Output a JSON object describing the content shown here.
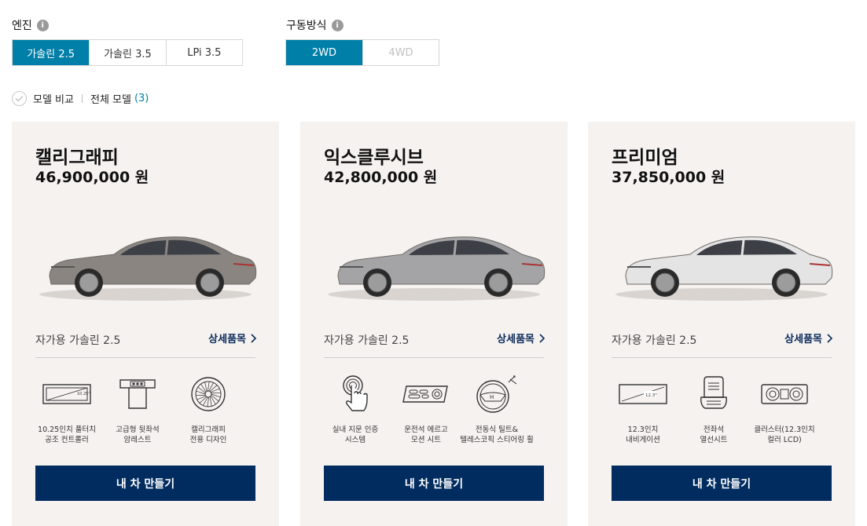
{
  "engine": {
    "label": "엔진",
    "options": [
      {
        "label": "가솔린 2.5",
        "state": "active"
      },
      {
        "label": "가솔린 3.5",
        "state": "normal"
      },
      {
        "label": "LPi 3.5",
        "state": "normal"
      }
    ]
  },
  "drive": {
    "label": "구동방식",
    "options": [
      {
        "label": "2WD",
        "state": "active"
      },
      {
        "label": "4WD",
        "state": "disabled"
      }
    ]
  },
  "compare": {
    "label": "모델 비교",
    "all_models_label": "전체 모델",
    "count": "(3)"
  },
  "colors": {
    "accent": "#007fa8",
    "navy": "#002c5f",
    "card_bg": "#f5f2f0"
  },
  "cards": [
    {
      "name": "캘리그래피",
      "price": "46,900,000 원",
      "sub": "자가용 가솔린 2.5",
      "detail": "상세품목",
      "car_color": "#8a8580",
      "features": [
        {
          "icon": "touch-screen-icon",
          "line1": "10.25인치 풀터치",
          "line2": "공조 컨트롤러",
          "badge": "10.25\""
        },
        {
          "icon": "rear-armrest-icon",
          "line1": "고급형 뒷좌석",
          "line2": "암레스트"
        },
        {
          "icon": "wheel-icon",
          "line1": "캘리그래피",
          "line2": "전용 디자인"
        }
      ],
      "cta": "내 차 만들기"
    },
    {
      "name": "익스클루시브",
      "price": "42,800,000 원",
      "sub": "자가용 가솔린 2.5",
      "detail": "상세품목",
      "car_color": "#a4a4a6",
      "features": [
        {
          "icon": "fingerprint-icon",
          "line1": "실내 지문 인증",
          "line2": "시스템"
        },
        {
          "icon": "seat-control-icon",
          "line1": "운전석 에르고",
          "line2": "모션 시트"
        },
        {
          "icon": "steering-wheel-icon",
          "line1": "전동식 틸트&",
          "line2": "텔레스코픽 스티어링 휠"
        }
      ],
      "cta": "내 차 만들기"
    },
    {
      "name": "프리미엄",
      "price": "37,850,000 원",
      "sub": "자가용 가솔린 2.5",
      "detail": "상세품목",
      "car_color": "#e4e4e4",
      "features": [
        {
          "icon": "navigation-screen-icon",
          "line1": "12.3인치",
          "line2": "내비게이션",
          "badge": "12.3\""
        },
        {
          "icon": "heated-seat-icon",
          "line1": "전좌석",
          "line2": "열선시트"
        },
        {
          "icon": "cluster-icon",
          "line1": "클러스터(12.3인치",
          "line2": "컬러 LCD)"
        }
      ],
      "cta": "내 차 만들기"
    }
  ]
}
